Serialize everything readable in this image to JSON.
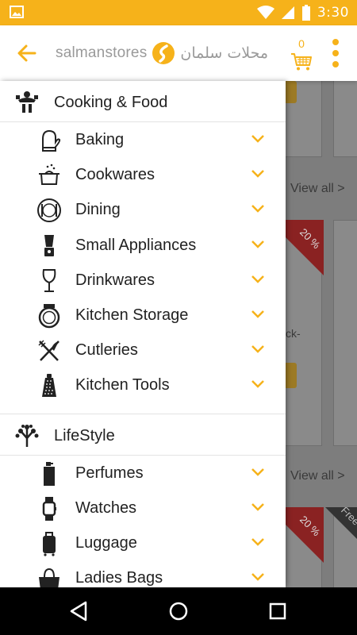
{
  "status_bar": {
    "time": "3:30",
    "icons": [
      "image-icon",
      "wifi-icon",
      "signal-icon",
      "battery-icon"
    ]
  },
  "app_bar": {
    "logo_text_en": "salmanstores",
    "logo_text_ar": "محلات سلمان",
    "cart_count": "0",
    "accent_color": "#f6b21a"
  },
  "drawer": {
    "sections": [
      {
        "title": "Cooking & Food",
        "icon": "chef-icon",
        "items": [
          {
            "label": "Baking",
            "icon": "oven-mitt-icon"
          },
          {
            "label": "Cookwares",
            "icon": "pot-icon"
          },
          {
            "label": "Dining",
            "icon": "plate-icon"
          },
          {
            "label": "Small Appliances",
            "icon": "blender-icon"
          },
          {
            "label": "Drinkwares",
            "icon": "wine-glass-icon"
          },
          {
            "label": "Kitchen Storage",
            "icon": "jar-icon"
          },
          {
            "label": "Cutleries",
            "icon": "fork-knife-icon"
          },
          {
            "label": "Kitchen Tools",
            "icon": "grater-icon"
          }
        ]
      },
      {
        "title": "LifeStyle",
        "icon": "tree-icon",
        "items": [
          {
            "label": "Perfumes",
            "icon": "perfume-icon"
          },
          {
            "label": "Watches",
            "icon": "watch-icon"
          },
          {
            "label": "Luggage",
            "icon": "luggage-icon"
          },
          {
            "label": "Ladies Bags",
            "icon": "handbag-icon"
          }
        ]
      }
    ]
  },
  "background": {
    "view_all_1": "View all >",
    "view_all_2": "View all >",
    "badge_1": "20 %",
    "badge_2": "20 %",
    "badge_3": "Free Ship",
    "partial_text": "ck-"
  }
}
